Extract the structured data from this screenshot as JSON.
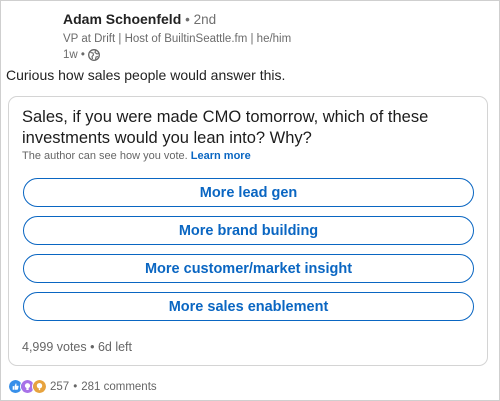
{
  "author": {
    "name": "Adam Schoenfeld",
    "degree": "• 2nd",
    "headline": "VP at Drift | Host of BuiltinSeattle.fm | he/him",
    "time": "1w •"
  },
  "post": {
    "text": "Curious how sales people would answer this."
  },
  "poll": {
    "question": "Sales, if you were made CMO tomorrow, which of these investments would you lean into? Why?",
    "vote_note": "The author can see how you vote.",
    "learn_more": "Learn more",
    "options": [
      "More lead gen",
      "More brand building",
      "More customer/market insight",
      "More sales enablement"
    ],
    "footer": "4,999 votes • 6d left"
  },
  "social": {
    "reaction_icons": [
      "like-icon",
      "insightful-icon",
      "curious-icon"
    ],
    "reaction_count": "257",
    "separator": "•",
    "comments": "281 comments"
  },
  "colors": {
    "accent": "#0a66c2",
    "like": "#378fe9",
    "insightful": "#915907",
    "curious": "#df704d"
  }
}
